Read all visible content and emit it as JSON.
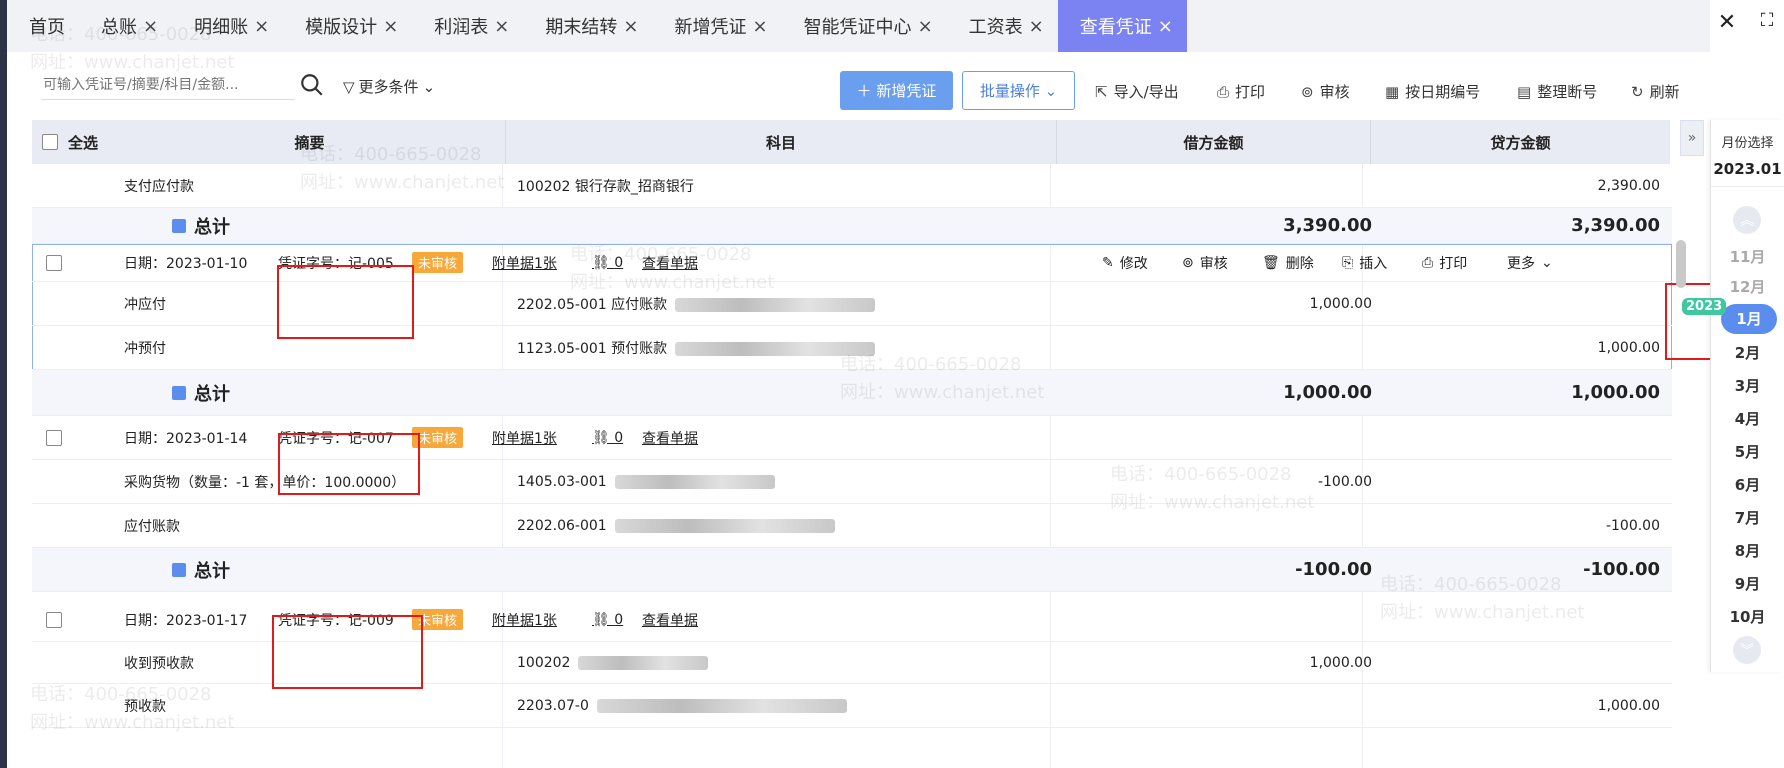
{
  "tabs": [
    {
      "label": "首页",
      "closable": false,
      "active": false
    },
    {
      "label": "总账",
      "closable": true,
      "active": false
    },
    {
      "label": "明细账",
      "closable": true,
      "active": false
    },
    {
      "label": "模版设计",
      "closable": true,
      "active": false
    },
    {
      "label": "利润表",
      "closable": true,
      "active": false
    },
    {
      "label": "期末结转",
      "closable": true,
      "active": false
    },
    {
      "label": "新增凭证",
      "closable": true,
      "active": false
    },
    {
      "label": "智能凭证中心",
      "closable": true,
      "active": false
    },
    {
      "label": "工资表",
      "closable": true,
      "active": false
    },
    {
      "label": "查看凭证",
      "closable": true,
      "active": true
    }
  ],
  "toolbar": {
    "search_placeholder": "可输入凭证号/摘要/科目/金额...",
    "more_conditions": "更多条件",
    "new_voucher": "新增凭证",
    "batch_ops": "批量操作",
    "import_export": "导入/导出",
    "print": "打印",
    "audit": "审核",
    "number_by_date": "按日期编号",
    "tidy_gaps": "整理断号",
    "refresh": "刷新"
  },
  "table_header": {
    "select_all": "全选",
    "summary": "摘要",
    "subject": "科目",
    "debit": "借方金额",
    "credit": "贷方金额"
  },
  "top_row": {
    "summary": "支付应付款",
    "subject": "100202 银行存款_招商银行",
    "debit": "",
    "credit": "2,390.00"
  },
  "top_total": {
    "label": "总计",
    "debit": "3,390.00",
    "credit": "3,390.00"
  },
  "vouchers": [
    {
      "date": "日期：2023-01-10",
      "number": "凭证字号：记-005",
      "status": "未审核",
      "attachments": "附单据1张",
      "links": "0",
      "view": "查看单据",
      "lines": [
        {
          "summary": "冲应付",
          "subject": "2202.05-001  应付账款",
          "debit": "1,000.00",
          "credit": ""
        },
        {
          "summary": "冲预付",
          "subject": "1123.05-001  预付账款",
          "debit": "",
          "credit": "1,000.00"
        }
      ],
      "total": {
        "label": "总计",
        "debit": "1,000.00",
        "credit": "1,000.00"
      }
    },
    {
      "date": "日期：2023-01-14",
      "number": "凭证字号：记-007",
      "status": "未审核",
      "attachments": "附单据1张",
      "links": "0",
      "view": "查看单据",
      "lines": [
        {
          "summary": "采购货物（数量：-1 套，单价：100.0000）",
          "subject": "1405.03-001",
          "debit": "-100.00",
          "credit": ""
        },
        {
          "summary": "应付账款",
          "subject": "2202.06-001",
          "debit": "",
          "credit": "-100.00"
        }
      ],
      "total": {
        "label": "总计",
        "debit": "-100.00",
        "credit": "-100.00"
      }
    },
    {
      "date": "日期：2023-01-17",
      "number": "凭证字号：记-009",
      "status": "未审核",
      "attachments": "附单据1张",
      "links": "0",
      "view": "查看单据",
      "lines": [
        {
          "summary": "收到预收款",
          "subject": "100202",
          "debit": "1,000.00",
          "credit": ""
        },
        {
          "summary": "预收款",
          "subject": "2203.07-0",
          "debit": "",
          "credit": "1,000.00"
        }
      ]
    }
  ],
  "row_actions": {
    "edit": "修改",
    "audit": "审核",
    "delete": "删除",
    "insert": "插入",
    "print": "打印",
    "more": "更多"
  },
  "month_picker": {
    "title": "月份选择",
    "value": "2023.01",
    "year_tag": "2023",
    "months": [
      "11月",
      "12月",
      "1月",
      "2月",
      "3月",
      "4月",
      "5月",
      "6月",
      "7月",
      "8月",
      "9月",
      "10月"
    ],
    "selected": "1月"
  },
  "watermark": {
    "phone": "电话：400-665-0028",
    "site": "网址：www.chanjet.net"
  },
  "colors": {
    "accent": "#7b83f2",
    "primary_button": "#6a9ff0",
    "badge": "#f7a83b",
    "highlight_box": "#e01b1b",
    "selected_month": "#5b8def"
  }
}
